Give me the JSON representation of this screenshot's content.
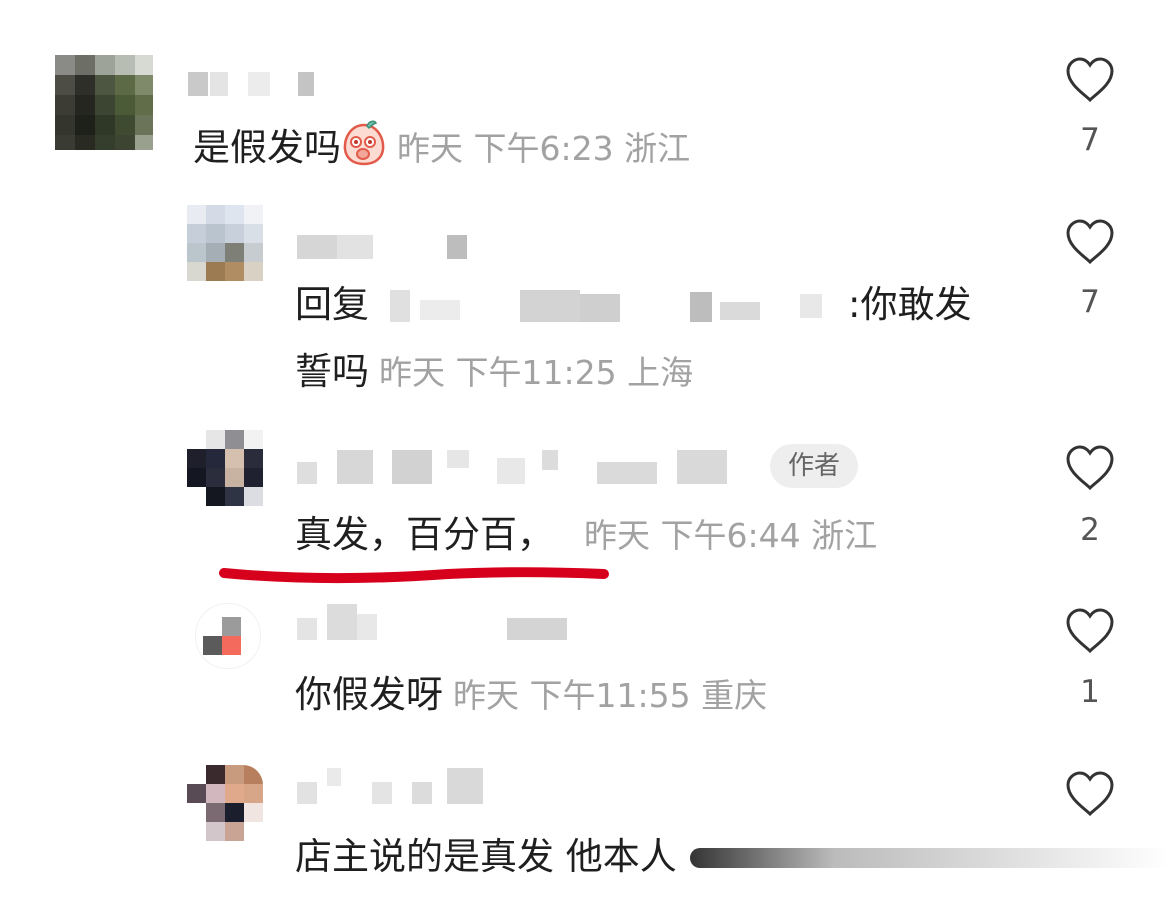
{
  "comments": [
    {
      "text": "是假发吗",
      "emoji": "embarrassed-peach-emoji",
      "time": "昨天 下午6:23 浙江",
      "likes": "7"
    },
    {
      "text_line1": "回复",
      "text_line1_end": ":你敢发",
      "text_line2": "誓吗",
      "time": "昨天 下午11:25 上海",
      "likes": "7"
    },
    {
      "author_tag": "作者",
      "text": "真发，百分百，",
      "time": "昨天 下午6:44 浙江",
      "likes": "2",
      "highlight_color": "#d6001c"
    },
    {
      "text": "你假发呀",
      "time": "昨天 下午11:55 重庆",
      "likes": "1"
    },
    {
      "text": "店主说的是真发 他本人",
      "likes": ""
    }
  ],
  "icons": {
    "like": "heart-outline-icon"
  },
  "colors": {
    "meta_text": "#a2a2a2",
    "underline": "#d6001c"
  }
}
